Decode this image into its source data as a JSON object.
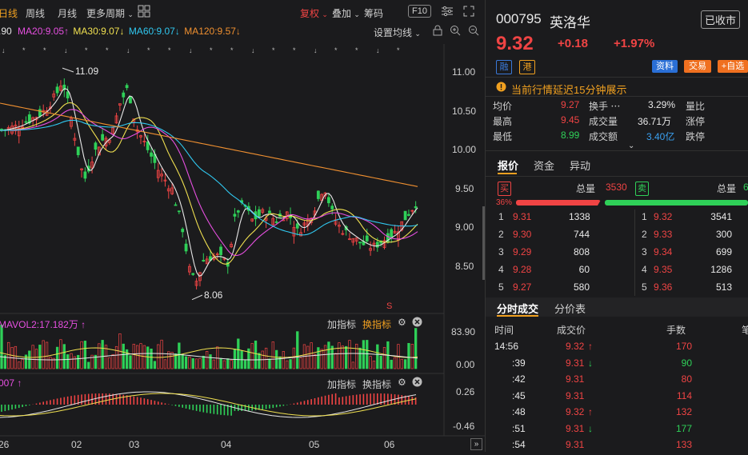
{
  "toolbar": {
    "tab_active": "日线",
    "tab_week": "周线",
    "tab_month": "月线",
    "more_periods": "更多周期",
    "fuquan": "复权",
    "diejia": "叠加",
    "chouma": "筹码",
    "f10": "F10"
  },
  "ma": {
    "ma5": ".90",
    "ma20": "MA20:9.05",
    "ma30": "MA30:9.07",
    "ma60": "MA60:9.07",
    "ma120": "MA120:9.57",
    "settings": "设置均线"
  },
  "price_axis": [
    "11.00",
    "10.50",
    "10.00",
    "9.50",
    "9.00",
    "8.50"
  ],
  "annotations": {
    "high": "11.09",
    "low": "8.06",
    "s_marker": "S"
  },
  "volume_panel": {
    "mavol": "MAVOL2:17.182万",
    "add": "加指标",
    "switch": "换指标",
    "axis_top": "83.90",
    "axis_bottom": "0.00"
  },
  "macd_panel": {
    "label": "007",
    "add": "加指标",
    "switch": "换指标",
    "axis_top": "0.26",
    "axis_bottom": "-0.46"
  },
  "date_axis": [
    "26",
    "02",
    "03",
    "04",
    "05",
    "06"
  ],
  "colors": {
    "up": "#f04444",
    "down": "#2fd058",
    "accent": "#f0a020",
    "ma5": "#e8e8e8",
    "ma20": "#e64fe0",
    "ma30": "#f0e050",
    "ma60": "#30c8f0",
    "ma120": "#f09030"
  },
  "quote": {
    "code": "000795",
    "name": "英洛华",
    "status": "已收市",
    "price": "9.32",
    "change": "+0.18",
    "change_pct": "+1.97%",
    "tag_rong": "融",
    "tag_gang": "港",
    "btn_info": "资料",
    "btn_trade": "交易",
    "btn_watch": "+自选",
    "notice": "当前行情延迟15分钟展示"
  },
  "stats": [
    {
      "k1": "均价",
      "v1": "9.27",
      "k2": "换手",
      "v2": "3.29%",
      "k3": "量比"
    },
    {
      "k1": "最高",
      "v1": "9.45",
      "k2": "成交量",
      "v2": "36.71万",
      "k3": "涨停"
    },
    {
      "k1": "最低",
      "v1": "8.99",
      "k2": "成交额",
      "v2": "3.40亿",
      "k3": "跌停"
    }
  ],
  "tabs": {
    "quote": "报价",
    "fund": "资金",
    "move": "异动"
  },
  "book_header": {
    "buy": "买",
    "total": "总量",
    "buy_total": "3530",
    "sell": "卖",
    "total2": "总量",
    "sell_total": "6",
    "ratio": "36%"
  },
  "bids": [
    {
      "n": "1",
      "p": "9.31",
      "v": "1338"
    },
    {
      "n": "2",
      "p": "9.30",
      "v": "744"
    },
    {
      "n": "3",
      "p": "9.29",
      "v": "808"
    },
    {
      "n": "4",
      "p": "9.28",
      "v": "60"
    },
    {
      "n": "5",
      "p": "9.27",
      "v": "580"
    }
  ],
  "asks": [
    {
      "n": "1",
      "p": "9.32",
      "v": "3541"
    },
    {
      "n": "2",
      "p": "9.33",
      "v": "300"
    },
    {
      "n": "3",
      "p": "9.34",
      "v": "699"
    },
    {
      "n": "4",
      "p": "9.35",
      "v": "1286"
    },
    {
      "n": "5",
      "p": "9.36",
      "v": "513"
    }
  ],
  "ticks_tabs": {
    "tick": "分时成交",
    "dist": "分价表"
  },
  "ticks_header": {
    "time": "时间",
    "price": "成交价",
    "vol": "手数"
  },
  "ticks": [
    {
      "t": "14:56",
      "p": "9.32",
      "dir": "up",
      "v": "170"
    },
    {
      "t": ":39",
      "p": "9.31",
      "dir": "down",
      "v": "90"
    },
    {
      "t": ":42",
      "p": "9.31",
      "dir": "none",
      "v": "80"
    },
    {
      "t": ":45",
      "p": "9.31",
      "dir": "none",
      "v": "114"
    },
    {
      "t": ":48",
      "p": "9.32",
      "dir": "up",
      "v": "132"
    },
    {
      "t": ":51",
      "p": "9.31",
      "dir": "down",
      "v": "177"
    },
    {
      "t": ":54",
      "p": "9.31",
      "dir": "none",
      "v": "133"
    }
  ]
}
